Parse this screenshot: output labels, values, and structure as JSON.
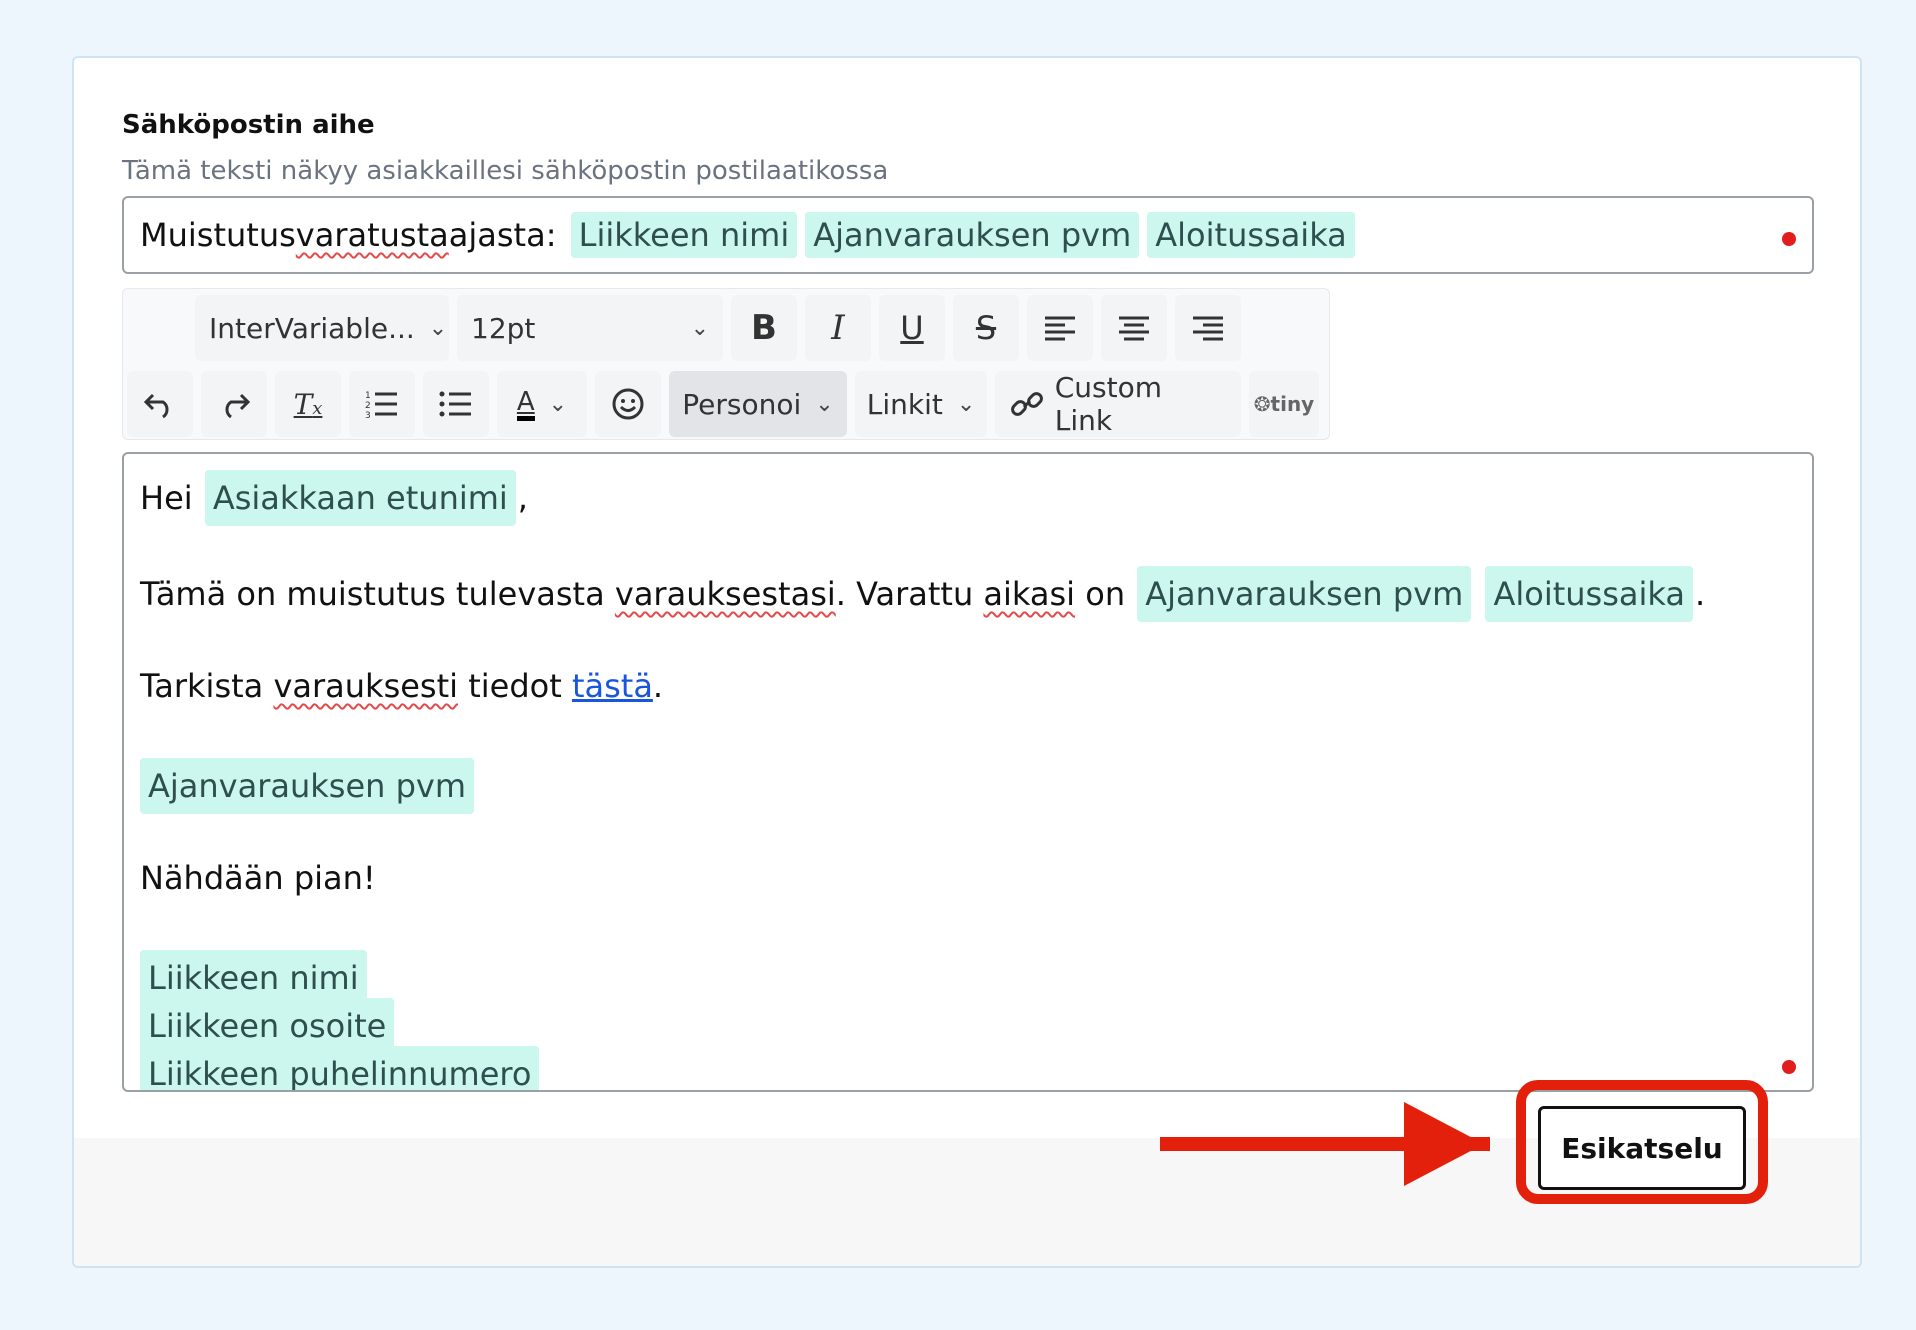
{
  "subject": {
    "label": "Sähköpostin aihe",
    "help": "Tämä teksti näkyy asiakkaillesi sähköpostin postilaatikossa",
    "text_prefix": "Muistutus ",
    "text_spell": "varatusta",
    "text_suffix": " ajasta:",
    "tags": [
      "Liikkeen nimi",
      "Ajanvarauksen pvm",
      "Aloitussaika"
    ]
  },
  "toolbar": {
    "font_family": "InterVariable...",
    "font_size": "12pt",
    "personalize": "Personoi",
    "links": "Linkit",
    "custom_link": "Custom Link",
    "brand": "tiny",
    "text_color": "A"
  },
  "body": {
    "greeting": "Hei",
    "greeting_tag": "Asiakkaan etunimi",
    "greeting_end": ",",
    "p1_a": "Tämä on muistutus tulevasta ",
    "p1_spell1": "varauksestasi",
    "p1_b": ". Varattu ",
    "p1_spell2": "aikasi",
    "p1_c": " on",
    "p1_tag1": "Ajanvarauksen pvm",
    "p1_tag2": "Aloitussaika",
    "p1_end": ".",
    "p2_a": "Tarkista ",
    "p2_spell": "varauksesti",
    "p2_b": " tiedot ",
    "p2_link": "tästä",
    "p2_end": ".",
    "date_tag": "Ajanvarauksen pvm",
    "closing": "Nähdään pian!",
    "sig_tags": [
      "Liikkeen nimi",
      "Liikkeen osoite",
      "Liikkeen puhelinnumero"
    ]
  },
  "footer": {
    "preview_button": "Esikatselu"
  },
  "colors": {
    "tag_bg": "#ccf7ef",
    "accent_red": "#e3200c",
    "link": "#1a56db"
  }
}
